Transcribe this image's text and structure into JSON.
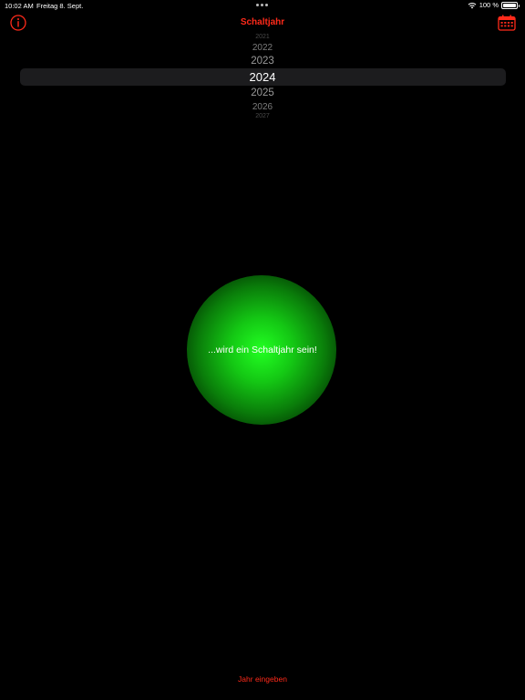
{
  "status_bar": {
    "time": "10:02 AM",
    "date": "Freitag 8. Sept.",
    "battery": "100 %",
    "battery_level": 1.0
  },
  "nav": {
    "title": "Schaltjahr",
    "info_icon": "info-icon",
    "calendar_icon": "calendar-icon"
  },
  "picker": {
    "years": [
      "2021",
      "2022",
      "2023",
      "2024",
      "2025",
      "2026",
      "2027"
    ],
    "selected": "2024"
  },
  "result": {
    "text": "...wird ein Schaltjahr sein!",
    "color": "#22ff22"
  },
  "bottom": {
    "button_label": "Jahr eingeben"
  },
  "colors": {
    "accent": "#ff2a1a",
    "background": "#000000"
  }
}
